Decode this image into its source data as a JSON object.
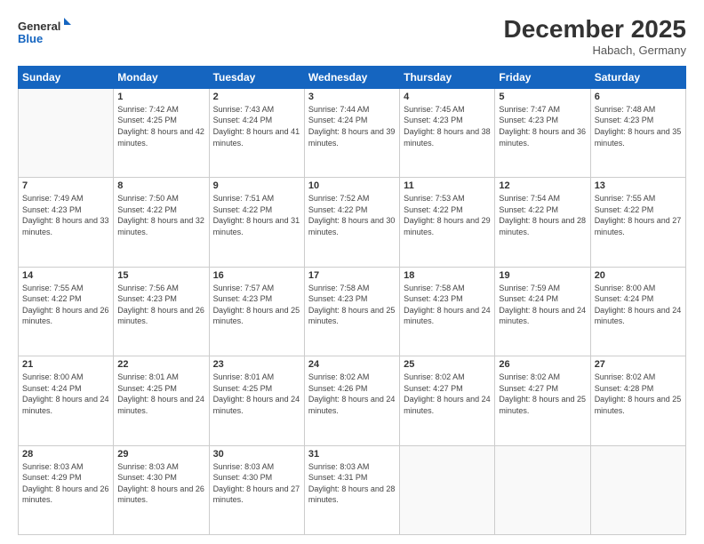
{
  "logo": {
    "line1": "General",
    "line2": "Blue"
  },
  "title": "December 2025",
  "subtitle": "Habach, Germany",
  "days_of_week": [
    "Sunday",
    "Monday",
    "Tuesday",
    "Wednesday",
    "Thursday",
    "Friday",
    "Saturday"
  ],
  "weeks": [
    [
      {
        "day": "",
        "sunrise": "",
        "sunset": "",
        "daylight": ""
      },
      {
        "day": "1",
        "sunrise": "Sunrise: 7:42 AM",
        "sunset": "Sunset: 4:25 PM",
        "daylight": "Daylight: 8 hours and 42 minutes."
      },
      {
        "day": "2",
        "sunrise": "Sunrise: 7:43 AM",
        "sunset": "Sunset: 4:24 PM",
        "daylight": "Daylight: 8 hours and 41 minutes."
      },
      {
        "day": "3",
        "sunrise": "Sunrise: 7:44 AM",
        "sunset": "Sunset: 4:24 PM",
        "daylight": "Daylight: 8 hours and 39 minutes."
      },
      {
        "day": "4",
        "sunrise": "Sunrise: 7:45 AM",
        "sunset": "Sunset: 4:23 PM",
        "daylight": "Daylight: 8 hours and 38 minutes."
      },
      {
        "day": "5",
        "sunrise": "Sunrise: 7:47 AM",
        "sunset": "Sunset: 4:23 PM",
        "daylight": "Daylight: 8 hours and 36 minutes."
      },
      {
        "day": "6",
        "sunrise": "Sunrise: 7:48 AM",
        "sunset": "Sunset: 4:23 PM",
        "daylight": "Daylight: 8 hours and 35 minutes."
      }
    ],
    [
      {
        "day": "7",
        "sunrise": "Sunrise: 7:49 AM",
        "sunset": "Sunset: 4:23 PM",
        "daylight": "Daylight: 8 hours and 33 minutes."
      },
      {
        "day": "8",
        "sunrise": "Sunrise: 7:50 AM",
        "sunset": "Sunset: 4:22 PM",
        "daylight": "Daylight: 8 hours and 32 minutes."
      },
      {
        "day": "9",
        "sunrise": "Sunrise: 7:51 AM",
        "sunset": "Sunset: 4:22 PM",
        "daylight": "Daylight: 8 hours and 31 minutes."
      },
      {
        "day": "10",
        "sunrise": "Sunrise: 7:52 AM",
        "sunset": "Sunset: 4:22 PM",
        "daylight": "Daylight: 8 hours and 30 minutes."
      },
      {
        "day": "11",
        "sunrise": "Sunrise: 7:53 AM",
        "sunset": "Sunset: 4:22 PM",
        "daylight": "Daylight: 8 hours and 29 minutes."
      },
      {
        "day": "12",
        "sunrise": "Sunrise: 7:54 AM",
        "sunset": "Sunset: 4:22 PM",
        "daylight": "Daylight: 8 hours and 28 minutes."
      },
      {
        "day": "13",
        "sunrise": "Sunrise: 7:55 AM",
        "sunset": "Sunset: 4:22 PM",
        "daylight": "Daylight: 8 hours and 27 minutes."
      }
    ],
    [
      {
        "day": "14",
        "sunrise": "Sunrise: 7:55 AM",
        "sunset": "Sunset: 4:22 PM",
        "daylight": "Daylight: 8 hours and 26 minutes."
      },
      {
        "day": "15",
        "sunrise": "Sunrise: 7:56 AM",
        "sunset": "Sunset: 4:23 PM",
        "daylight": "Daylight: 8 hours and 26 minutes."
      },
      {
        "day": "16",
        "sunrise": "Sunrise: 7:57 AM",
        "sunset": "Sunset: 4:23 PM",
        "daylight": "Daylight: 8 hours and 25 minutes."
      },
      {
        "day": "17",
        "sunrise": "Sunrise: 7:58 AM",
        "sunset": "Sunset: 4:23 PM",
        "daylight": "Daylight: 8 hours and 25 minutes."
      },
      {
        "day": "18",
        "sunrise": "Sunrise: 7:58 AM",
        "sunset": "Sunset: 4:23 PM",
        "daylight": "Daylight: 8 hours and 24 minutes."
      },
      {
        "day": "19",
        "sunrise": "Sunrise: 7:59 AM",
        "sunset": "Sunset: 4:24 PM",
        "daylight": "Daylight: 8 hours and 24 minutes."
      },
      {
        "day": "20",
        "sunrise": "Sunrise: 8:00 AM",
        "sunset": "Sunset: 4:24 PM",
        "daylight": "Daylight: 8 hours and 24 minutes."
      }
    ],
    [
      {
        "day": "21",
        "sunrise": "Sunrise: 8:00 AM",
        "sunset": "Sunset: 4:24 PM",
        "daylight": "Daylight: 8 hours and 24 minutes."
      },
      {
        "day": "22",
        "sunrise": "Sunrise: 8:01 AM",
        "sunset": "Sunset: 4:25 PM",
        "daylight": "Daylight: 8 hours and 24 minutes."
      },
      {
        "day": "23",
        "sunrise": "Sunrise: 8:01 AM",
        "sunset": "Sunset: 4:25 PM",
        "daylight": "Daylight: 8 hours and 24 minutes."
      },
      {
        "day": "24",
        "sunrise": "Sunrise: 8:02 AM",
        "sunset": "Sunset: 4:26 PM",
        "daylight": "Daylight: 8 hours and 24 minutes."
      },
      {
        "day": "25",
        "sunrise": "Sunrise: 8:02 AM",
        "sunset": "Sunset: 4:27 PM",
        "daylight": "Daylight: 8 hours and 24 minutes."
      },
      {
        "day": "26",
        "sunrise": "Sunrise: 8:02 AM",
        "sunset": "Sunset: 4:27 PM",
        "daylight": "Daylight: 8 hours and 25 minutes."
      },
      {
        "day": "27",
        "sunrise": "Sunrise: 8:02 AM",
        "sunset": "Sunset: 4:28 PM",
        "daylight": "Daylight: 8 hours and 25 minutes."
      }
    ],
    [
      {
        "day": "28",
        "sunrise": "Sunrise: 8:03 AM",
        "sunset": "Sunset: 4:29 PM",
        "daylight": "Daylight: 8 hours and 26 minutes."
      },
      {
        "day": "29",
        "sunrise": "Sunrise: 8:03 AM",
        "sunset": "Sunset: 4:30 PM",
        "daylight": "Daylight: 8 hours and 26 minutes."
      },
      {
        "day": "30",
        "sunrise": "Sunrise: 8:03 AM",
        "sunset": "Sunset: 4:30 PM",
        "daylight": "Daylight: 8 hours and 27 minutes."
      },
      {
        "day": "31",
        "sunrise": "Sunrise: 8:03 AM",
        "sunset": "Sunset: 4:31 PM",
        "daylight": "Daylight: 8 hours and 28 minutes."
      },
      {
        "day": "",
        "sunrise": "",
        "sunset": "",
        "daylight": ""
      },
      {
        "day": "",
        "sunrise": "",
        "sunset": "",
        "daylight": ""
      },
      {
        "day": "",
        "sunrise": "",
        "sunset": "",
        "daylight": ""
      }
    ]
  ]
}
